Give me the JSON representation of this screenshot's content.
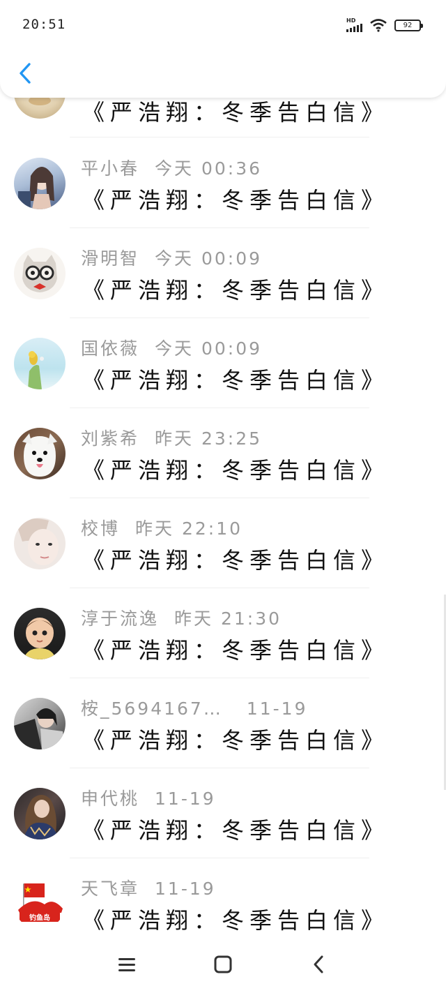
{
  "status_bar": {
    "time": "20:51",
    "network": "HD",
    "battery": "92"
  },
  "message": "《严浩翔：冬季告白信》",
  "rows": [
    {
      "name": "",
      "time": "",
      "avatar": "avatar-partial"
    },
    {
      "name": "平小春",
      "time": "今天 00:36",
      "avatar": "anime-girl"
    },
    {
      "name": "滑明智",
      "time": "今天 00:09",
      "avatar": "cat-glasses"
    },
    {
      "name": "国依薇",
      "time": "今天 00:09",
      "avatar": "bird"
    },
    {
      "name": "刘紫希",
      "time": "昨天 23:25",
      "avatar": "white-dog"
    },
    {
      "name": "校博",
      "time": "昨天 22:10",
      "avatar": "girl-face"
    },
    {
      "name": "淳于流逸",
      "time": "昨天 21:30",
      "avatar": "child"
    },
    {
      "name": "桉_5694167…",
      "time": "11-19",
      "avatar": "people"
    },
    {
      "name": "申代桃",
      "time": "11-19",
      "avatar": "woman"
    },
    {
      "name": "天飞章",
      "time": "11-19",
      "avatar": "flag-logo",
      "logo_text": "钓鱼岛"
    }
  ],
  "colors": {
    "accent": "#2196f3",
    "meta_text": "#9a9a9a",
    "flag_red": "#d8241c",
    "flag_star": "#ffde00"
  }
}
